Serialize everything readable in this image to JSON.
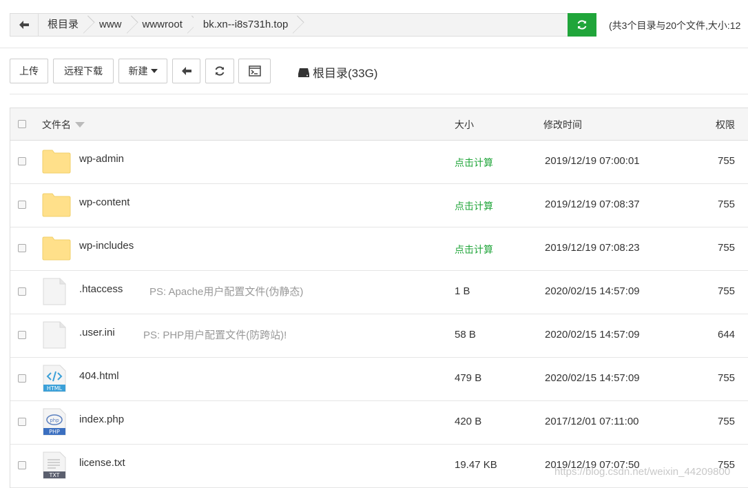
{
  "breadcrumb": {
    "items": [
      "根目录",
      "www",
      "wwwroot",
      "bk.xn--i8s731h.top"
    ],
    "summary": "(共3个目录与20个文件,大小:12"
  },
  "toolbar": {
    "upload": "上传",
    "remote_download": "远程下载",
    "new": "新建",
    "disk_label": "根目录(33G)"
  },
  "table": {
    "headers": {
      "name": "文件名",
      "size": "大小",
      "modified": "修改时间",
      "perm": "权限"
    },
    "rows": [
      {
        "name": "wp-admin",
        "type": "folder",
        "note": "",
        "size": "点击计算",
        "modified": "2019/12/19 07:00:01",
        "perm": "755"
      },
      {
        "name": "wp-content",
        "type": "folder",
        "note": "",
        "size": "点击计算",
        "modified": "2019/12/19 07:08:37",
        "perm": "755"
      },
      {
        "name": "wp-includes",
        "type": "folder",
        "note": "",
        "size": "点击计算",
        "modified": "2019/12/19 07:08:23",
        "perm": "755"
      },
      {
        "name": ".htaccess",
        "type": "file",
        "note": "PS: Apache用户配置文件(伪静态)",
        "size": "1 B",
        "modified": "2020/02/15 14:57:09",
        "perm": "755"
      },
      {
        "name": ".user.ini",
        "type": "file",
        "note": "PS: PHP用户配置文件(防跨站)!",
        "size": "58 B",
        "modified": "2020/02/15 14:57:09",
        "perm": "644"
      },
      {
        "name": "404.html",
        "type": "html",
        "note": "",
        "size": "479 B",
        "modified": "2020/02/15 14:57:09",
        "perm": "755"
      },
      {
        "name": "index.php",
        "type": "php",
        "note": "",
        "size": "420 B",
        "modified": "2017/12/01 07:11:00",
        "perm": "755"
      },
      {
        "name": "license.txt",
        "type": "txt",
        "note": "",
        "size": "19.47 KB",
        "modified": "2019/12/19 07:07:50",
        "perm": "755"
      }
    ]
  },
  "watermark": "https://blog.csdn.net/weixin_44209800",
  "colors": {
    "accent": "#20a53a",
    "folder": "#ffe08a"
  }
}
